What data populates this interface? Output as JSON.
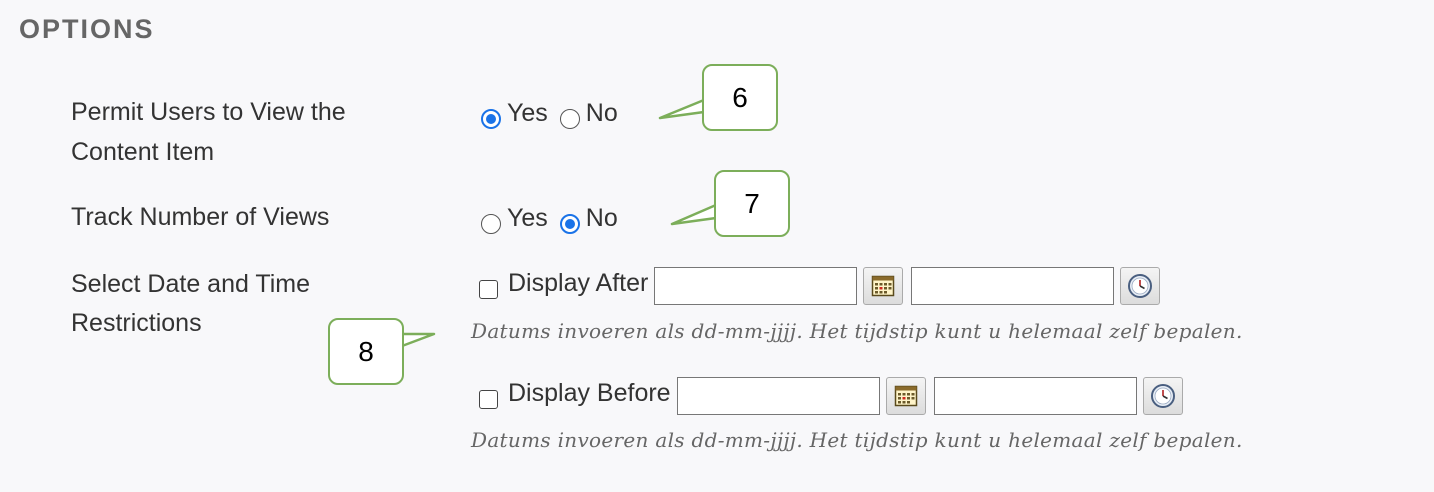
{
  "section": {
    "title": "OPTIONS"
  },
  "permit_view": {
    "label_line1": "Permit Users to View the",
    "label_line2": "Content Item",
    "yes_label": "Yes",
    "no_label": "No",
    "selected": "Yes"
  },
  "track_views": {
    "label": "Track Number of Views",
    "yes_label": "Yes",
    "no_label": "No",
    "selected": "No"
  },
  "date_restrictions": {
    "label_line1": "Select Date and Time",
    "label_line2": "Restrictions",
    "display_after": {
      "label": "Display After",
      "checked": false,
      "date_value": "",
      "time_value": "",
      "hint": "Datums invoeren als dd-mm-jjjj. Het tijdstip kunt u helemaal zelf bepalen."
    },
    "display_before": {
      "label": "Display Before",
      "checked": false,
      "date_value": "",
      "time_value": "",
      "hint": "Datums invoeren als dd-mm-jjjj. Het tijdstip kunt u helemaal zelf bepalen."
    }
  },
  "callouts": {
    "c6": "6",
    "c7": "7",
    "c8": "8"
  },
  "icons": {
    "calendar": "calendar-icon",
    "clock": "clock-icon"
  },
  "colors": {
    "radio_selected": "#1a73e8",
    "callout_border": "#7cae5a",
    "background": "#f8f8fa"
  }
}
